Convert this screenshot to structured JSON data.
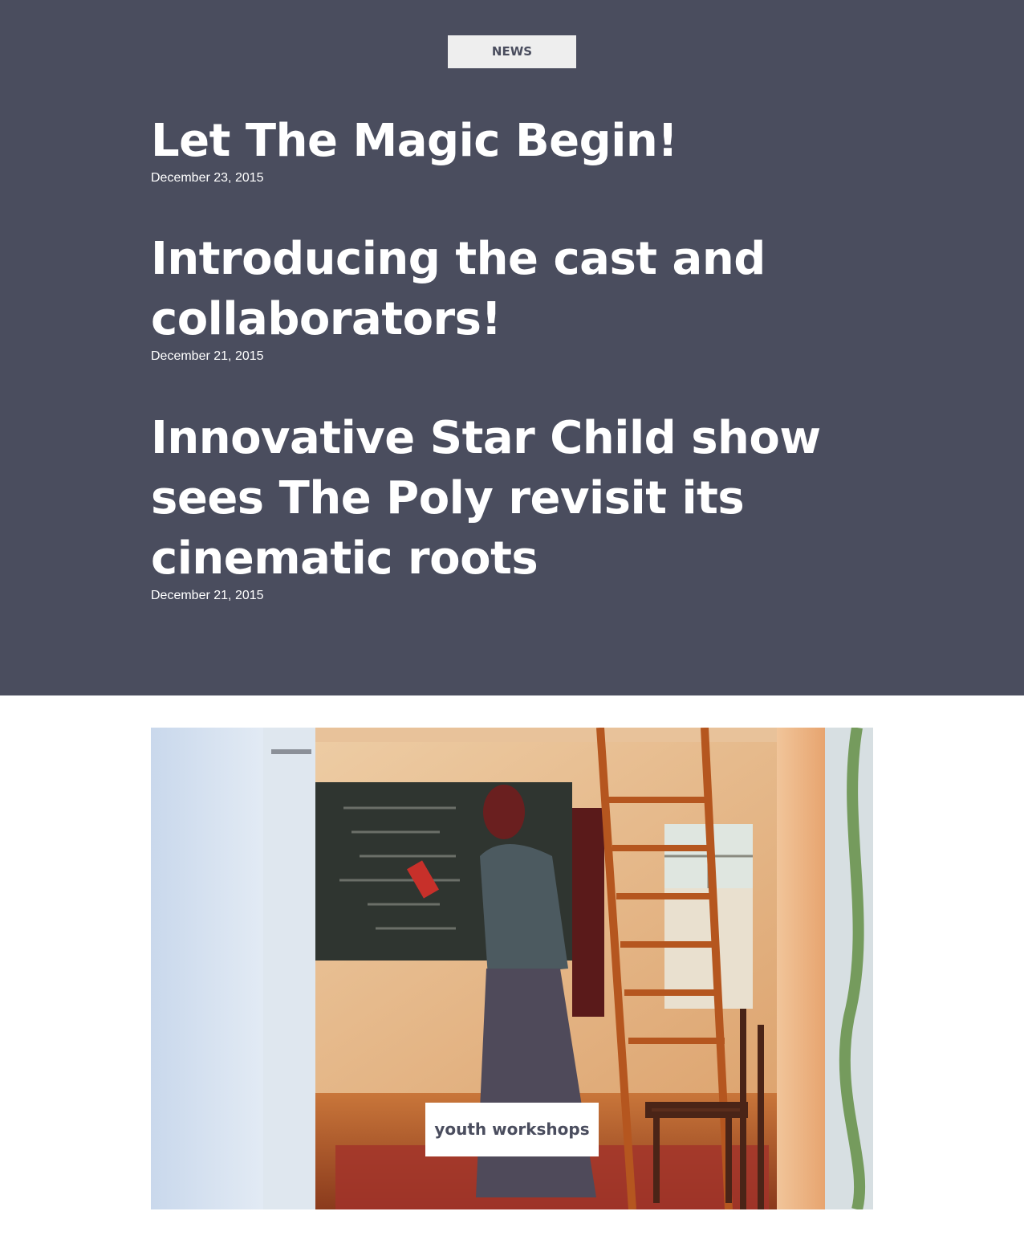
{
  "news": {
    "label": "NEWS",
    "colors": {
      "background": "#4a4d5e",
      "label_bg": "#eeeeee",
      "text": "#ffffff"
    },
    "posts": [
      {
        "title": "Let The Magic Begin!",
        "date": "December 23, 2015"
      },
      {
        "title": "Introducing the cast and collaborators!",
        "date": "December 21, 2015"
      },
      {
        "title": "Innovative Star Child show sees The Poly revisit its cinematic roots",
        "date": "December 21, 2015"
      }
    ]
  },
  "feature": {
    "tag": "youth workshops"
  }
}
